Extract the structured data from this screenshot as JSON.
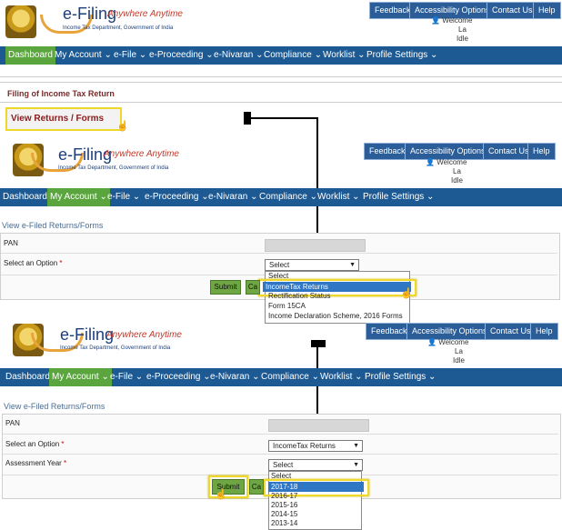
{
  "brand": {
    "title": "e-Filing",
    "tagline": "Anywhere Anytime",
    "subtitle": "Income Tax Department, Government of India"
  },
  "top_buttons": [
    "Feedback",
    "Accessibility Options",
    "Contact Us",
    "Help"
  ],
  "welcome": {
    "greeting": "Welcome",
    "line1": "La",
    "line2": "Idle"
  },
  "nav": {
    "items": [
      "Dashboard",
      "My Account",
      "e-File",
      "e-Proceeding",
      "e-Nivaran",
      "Compliance",
      "Worklist",
      "Profile Settings"
    ],
    "caret": "⌄"
  },
  "panel1": {
    "breadcrumb": "Filing of Income Tax Return",
    "link": "View Returns / Forms"
  },
  "panel2": {
    "section_title": "View e-Filed Returns/Forms",
    "pan_label": "PAN",
    "option_label": "Select an Option",
    "required": "*",
    "select_value": "Select",
    "options": [
      "Select",
      "IncomeTax Returns",
      "Rectification Status",
      "Form 15CA",
      "Income Declaration Scheme, 2016 Forms"
    ],
    "submit": "Submit",
    "cancel_fragment": "Ca"
  },
  "panel3": {
    "section_title": "View e-Filed Returns/Forms",
    "pan_label": "PAN",
    "option_label": "Select an Option",
    "option_value": "IncomeTax Returns",
    "ay_label": "Assessment Year",
    "required": "*",
    "select_value": "Select",
    "years": [
      "Select",
      "2017-18",
      "2016-17",
      "2015-16",
      "2014-15",
      "2013-14"
    ],
    "submit": "Submit",
    "cancel_fragment": "Ca"
  },
  "colors": {
    "nav_blue": "#1d5a93",
    "active_green": "#5aa53e",
    "highlight_yellow": "#f0d82a",
    "selected_blue": "#2f76c4"
  }
}
